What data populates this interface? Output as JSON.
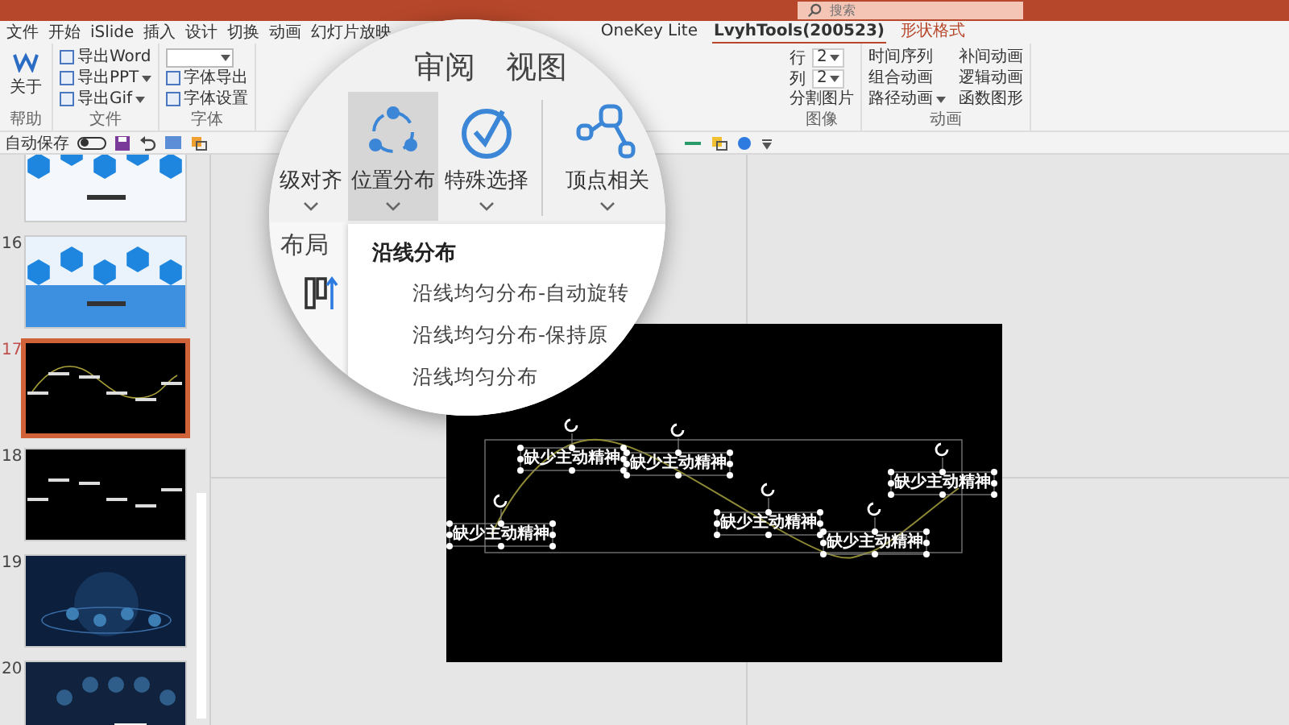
{
  "search": {
    "placeholder": "搜索"
  },
  "tabs_left": [
    {
      "label": "文件",
      "selected": false
    },
    {
      "label": "开始",
      "selected": false
    },
    {
      "label": "iSlide",
      "selected": false
    },
    {
      "label": "插入",
      "selected": false
    },
    {
      "label": "设计",
      "selected": false
    },
    {
      "label": "切换",
      "selected": false
    },
    {
      "label": "动画",
      "selected": false
    },
    {
      "label": "幻灯片放映",
      "selected": false
    }
  ],
  "tabs_right": [
    {
      "label": "OneKey Lite",
      "selected": false,
      "kind": "normal"
    },
    {
      "label": "LvyhTools(200523)",
      "selected": true,
      "kind": "normal"
    },
    {
      "label": "形状格式",
      "selected": false,
      "kind": "context"
    }
  ],
  "ribbon_left": [
    {
      "label": "帮助",
      "items": [
        {
          "kind": "large",
          "text": "关于"
        }
      ]
    },
    {
      "label": "文件",
      "items": [
        {
          "kind": "small",
          "text": "导出Word"
        },
        {
          "kind": "menu",
          "text": "导出PPT"
        },
        {
          "kind": "menu",
          "text": "导出Gif"
        }
      ]
    },
    {
      "label": "字体",
      "items": [
        {
          "kind": "dropdown"
        },
        {
          "kind": "small",
          "text": "字体导出"
        },
        {
          "kind": "small",
          "text": "字体设置"
        }
      ]
    }
  ],
  "ribbon_right": [
    {
      "label": "图像",
      "items": [
        {
          "kind": "spinner",
          "text": "行",
          "value": "2"
        },
        {
          "kind": "spinner",
          "text": "列",
          "value": "2"
        },
        {
          "kind": "plain",
          "text": "分割图片"
        }
      ]
    },
    {
      "label": "动画",
      "items": [
        {
          "kind": "plain",
          "text": "时间序列"
        },
        {
          "kind": "plain",
          "text": "组合动画"
        },
        {
          "kind": "menu",
          "text": "路径动画"
        },
        {
          "kind": "plain",
          "text": "补间动画"
        },
        {
          "kind": "plain",
          "text": "逻辑动画"
        },
        {
          "kind": "plain",
          "text": "函数图形"
        }
      ]
    }
  ],
  "quick_access": {
    "autosave_label": "自动保存",
    "autosave_on": false
  },
  "slides": [
    {
      "kind": "blue-hex",
      "selected": false
    },
    {
      "number": "16",
      "kind": "blue-glow",
      "selected": false
    },
    {
      "number": "17",
      "kind": "black-curve",
      "selected": true
    },
    {
      "number": "18",
      "kind": "black-text",
      "selected": false
    },
    {
      "number": "19",
      "kind": "dark-globe",
      "selected": false
    },
    {
      "number": "20",
      "kind": "dark-network",
      "selected": false
    }
  ],
  "slide": {
    "selected": true,
    "text_boxes": [
      {
        "text": "缺少主动精神"
      },
      {
        "text": "缺少主动精神"
      },
      {
        "text": "缺少主动精神"
      },
      {
        "text": "缺少主动精神"
      },
      {
        "text": "缺少主动精神"
      },
      {
        "text": "缺少主动精神"
      }
    ]
  },
  "magnifier": {
    "tabs": [
      "审阅",
      "视图"
    ],
    "buttons": [
      {
        "label": "级对齐",
        "selected": false
      },
      {
        "label": "位置分布",
        "selected": true
      },
      {
        "label": "特殊选择",
        "selected": false
      },
      {
        "label": "顶点相关",
        "selected": false
      }
    ],
    "group_label": "布局",
    "menu": {
      "header": "沿线分布",
      "items": [
        "沿线均匀分布-自动旋转",
        "沿线均匀分布-保持原",
        "沿线均匀分布"
      ]
    }
  }
}
